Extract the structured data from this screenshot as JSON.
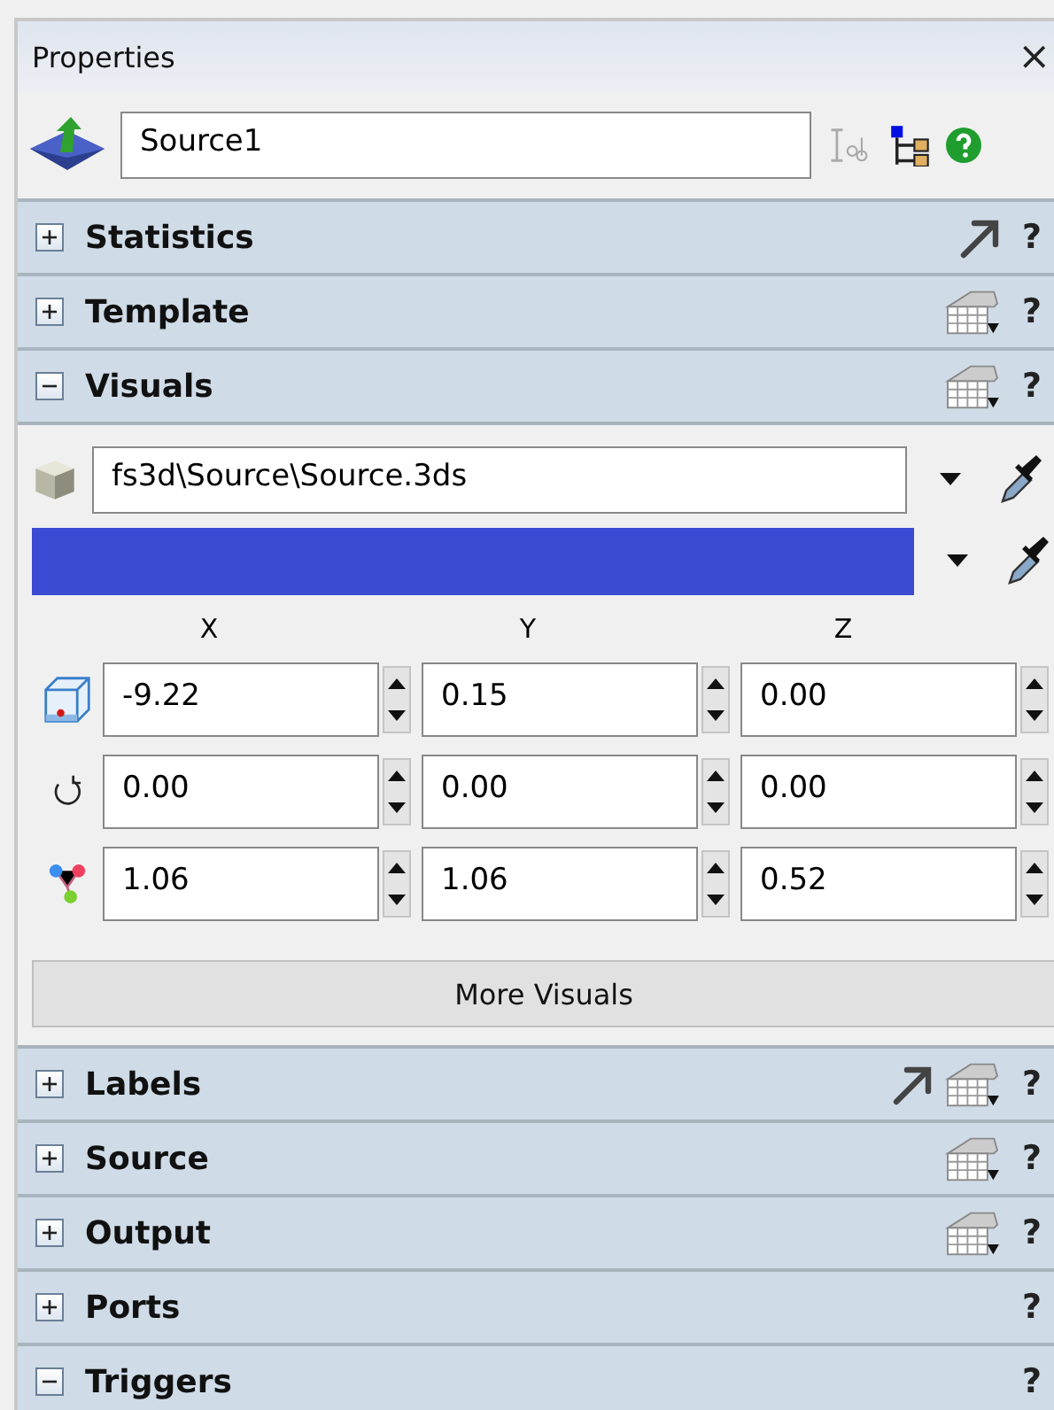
{
  "panel": {
    "title": "Properties",
    "close": "×"
  },
  "object": {
    "name": "Source1"
  },
  "sections": [
    {
      "label": "Statistics",
      "expanded": false,
      "pointer_icon": true,
      "template_icon": false,
      "help": "?"
    },
    {
      "label": "Template",
      "expanded": false,
      "pointer_icon": false,
      "template_icon": true,
      "help": "?"
    },
    {
      "label": "Visuals",
      "expanded": true,
      "pointer_icon": false,
      "template_icon": true,
      "help": "?",
      "content": {
        "shape_file": "fs3d\\Source\\Source.3ds",
        "color": "#3b4bd1",
        "axes": [
          "X",
          "Y",
          "Z"
        ],
        "rows": [
          {
            "kind": "position",
            "values": [
              "-9.22",
              "0.15",
              "0.00"
            ]
          },
          {
            "kind": "rotation",
            "values": [
              "0.00",
              "0.00",
              "0.00"
            ]
          },
          {
            "kind": "size",
            "values": [
              "1.06",
              "1.06",
              "0.52"
            ]
          }
        ],
        "more_button": "More Visuals"
      }
    },
    {
      "label": "Labels",
      "expanded": false,
      "pointer_icon": true,
      "template_icon": true,
      "help": "?"
    },
    {
      "label": "Source",
      "expanded": false,
      "pointer_icon": false,
      "template_icon": true,
      "help": "?"
    },
    {
      "label": "Output",
      "expanded": false,
      "pointer_icon": false,
      "template_icon": true,
      "help": "?"
    },
    {
      "label": "Ports",
      "expanded": false,
      "pointer_icon": false,
      "template_icon": false,
      "help": "?"
    },
    {
      "label": "Triggers",
      "expanded": true,
      "pointer_icon": false,
      "template_icon": false,
      "help": "?"
    }
  ]
}
